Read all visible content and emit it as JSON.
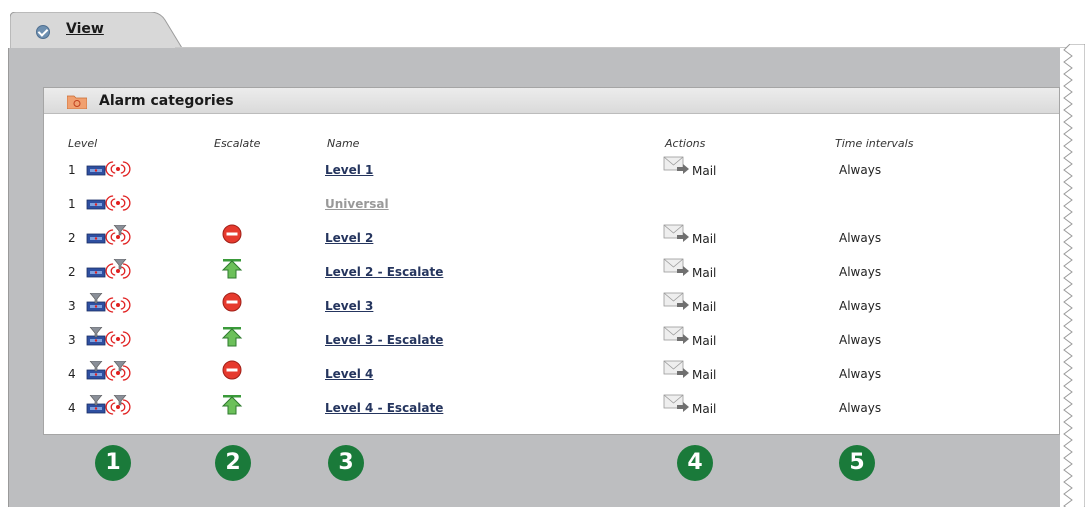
{
  "tab": {
    "label": "View"
  },
  "section": {
    "title": "Alarm categories"
  },
  "columns": {
    "level": "Level",
    "escalate": "Escalate",
    "name": "Name",
    "actions": "Actions",
    "time": "Time intervals"
  },
  "rows": [
    {
      "level": "1",
      "icons": "level-1-icon",
      "escalate": "",
      "name": "Level 1",
      "disabled": false,
      "action": "Mail",
      "time": "Always"
    },
    {
      "level": "1",
      "icons": "level-1-icon",
      "escalate": "",
      "name": "Universal",
      "disabled": true,
      "action": "",
      "time": ""
    },
    {
      "level": "2",
      "icons": "level-2-icon",
      "escalate": "stop",
      "name": "Level 2",
      "disabled": false,
      "action": "Mail",
      "time": "Always"
    },
    {
      "level": "2",
      "icons": "level-2-icon",
      "escalate": "up",
      "name": "Level 2 - Escalate",
      "disabled": false,
      "action": "Mail",
      "time": "Always"
    },
    {
      "level": "3",
      "icons": "level-3-icon",
      "escalate": "stop",
      "name": "Level 3",
      "disabled": false,
      "action": "Mail",
      "time": "Always"
    },
    {
      "level": "3",
      "icons": "level-3-icon",
      "escalate": "up",
      "name": "Level 3 - Escalate",
      "disabled": false,
      "action": "Mail",
      "time": "Always"
    },
    {
      "level": "4",
      "icons": "level-4-icon",
      "escalate": "stop",
      "name": "Level 4",
      "disabled": false,
      "action": "Mail",
      "time": "Always"
    },
    {
      "level": "4",
      "icons": "level-4-icon",
      "escalate": "up",
      "name": "Level 4 - Escalate",
      "disabled": false,
      "action": "Mail",
      "time": "Always"
    }
  ],
  "callouts": [
    "1",
    "2",
    "3",
    "4",
    "5"
  ],
  "colors": {
    "link": "#25355e",
    "callout": "#1a7a3a",
    "panel": "#bdbec0"
  }
}
